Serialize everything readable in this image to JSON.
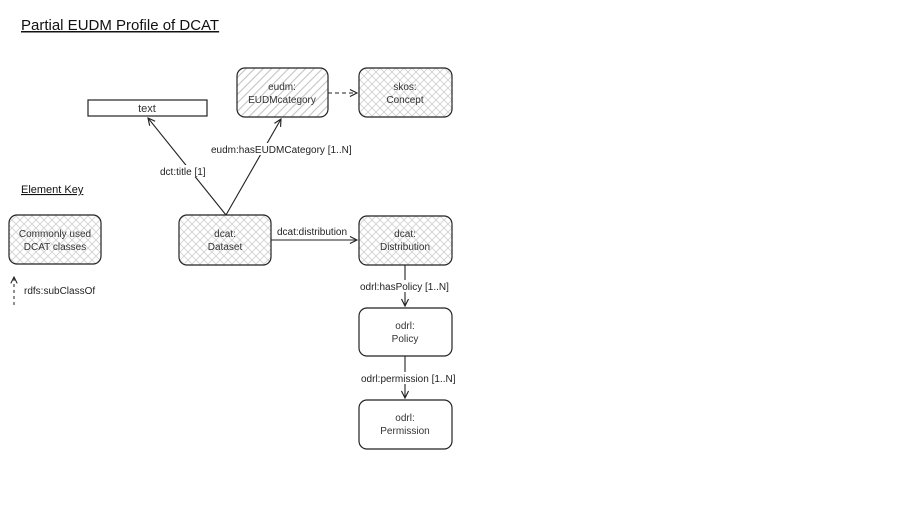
{
  "title": "Partial EUDM Profile of DCAT",
  "key": {
    "title": "Element Key",
    "class_box": [
      "Commonly used",
      "DCAT classes"
    ],
    "subclass_label": "rdfs:subClassOf"
  },
  "nodes": {
    "text": [
      "text"
    ],
    "eudm_category": [
      "eudm:",
      "EUDMcategory"
    ],
    "skos_concept": [
      "skos:",
      "Concept"
    ],
    "dataset": [
      "dcat:",
      "Dataset"
    ],
    "distribution": [
      "dcat:",
      "Distribution"
    ],
    "policy": [
      "odrl:",
      "Policy"
    ],
    "permission": [
      "odrl:",
      "Permission"
    ]
  },
  "edges": {
    "title": "dct:title [1]",
    "has_category": "eudm:hasEUDMCategory [1..N]",
    "distribution": "dcat:distribution",
    "has_policy": "odrl:hasPolicy [1..N]",
    "permission": "odrl:permission [1..N]"
  },
  "colors": {
    "stroke": "#222222",
    "hatch": "#c8c8c8"
  }
}
